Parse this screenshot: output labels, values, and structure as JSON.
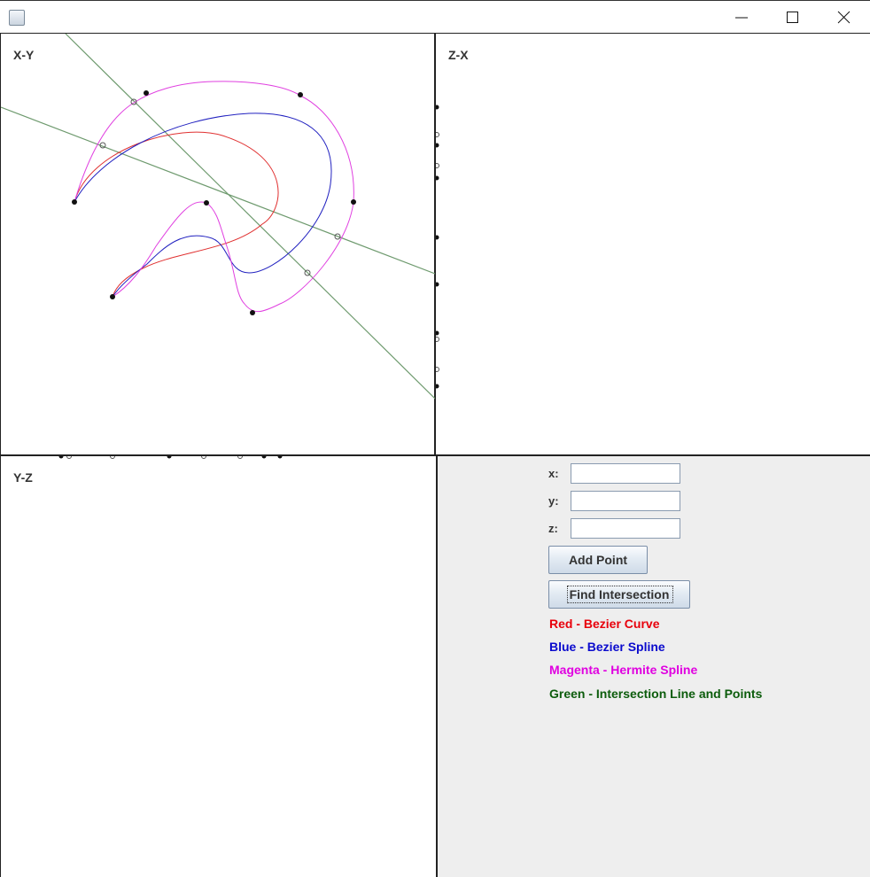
{
  "window": {
    "title": "",
    "controls": {
      "minimize": "minimize",
      "maximize": "maximize",
      "close": "close"
    }
  },
  "views": {
    "xy": {
      "label": "X-Y"
    },
    "zx": {
      "label": "Z-X"
    },
    "yz": {
      "label": "Y-Z"
    }
  },
  "form": {
    "x_label": "x:",
    "y_label": "y:",
    "z_label": "z:",
    "x_value": "",
    "y_value": "",
    "z_value": "",
    "add_button": "Add Point",
    "find_button": "Find Intersection"
  },
  "legend": [
    {
      "text": "Red - Bezier Curve",
      "color": "#e8000b"
    },
    {
      "text": "Blue - Bezier Spline",
      "color": "#0a0acd"
    },
    {
      "text": "Magenta - Hermite Spline",
      "color": "#e000e0"
    },
    {
      "text": "Green - Intersection Line and Points",
      "color": "#0c5c0c"
    }
  ],
  "colors": {
    "bezier_curve": "#e03030",
    "bezier_spline": "#2222c0",
    "hermite_spline": "#e040e0",
    "intersection": "#6e9a6e",
    "control_point": "#111111"
  }
}
